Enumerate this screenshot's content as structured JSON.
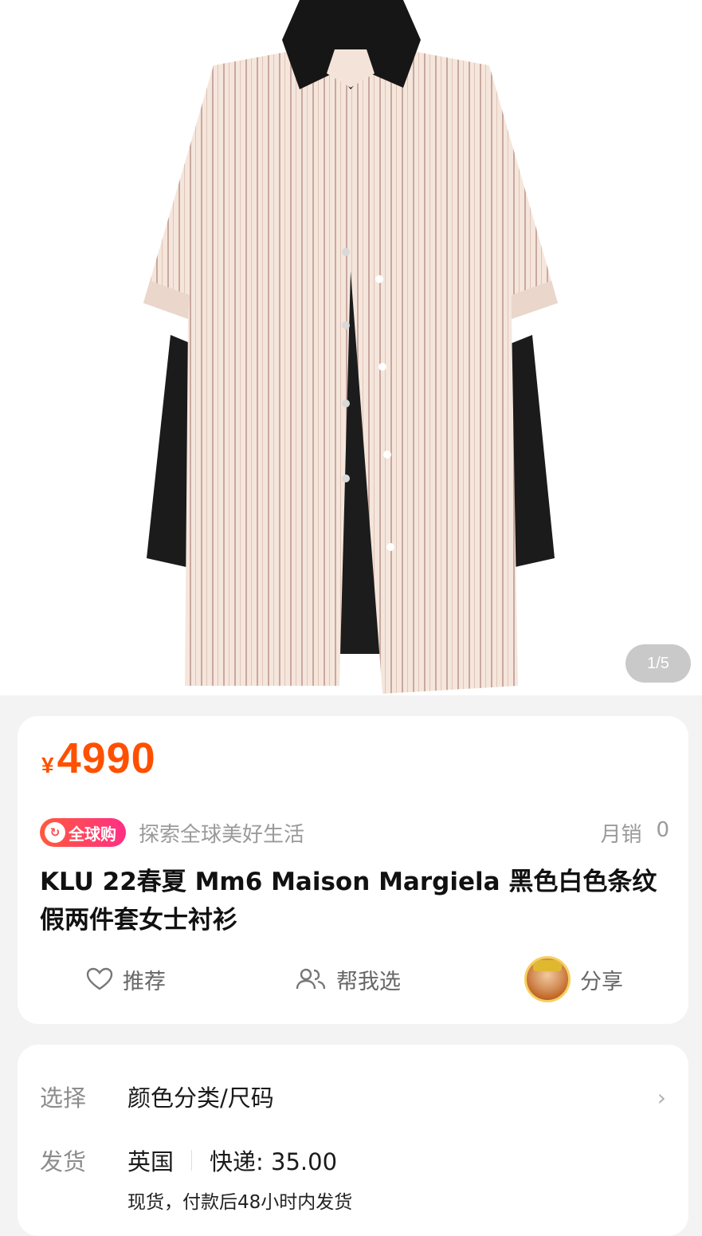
{
  "gallery": {
    "page_indicator": "1/5",
    "image_alt": "shirt-product-photo"
  },
  "price": {
    "symbol": "¥",
    "value": "4990"
  },
  "tags": {
    "badge_label": "全球购",
    "slogan": "探索全球美好生活",
    "monthly_sales_label": "月销",
    "monthly_sales_value": "0"
  },
  "product": {
    "title": "KLU 22春夏 Mm6 Maison Margiela 黑色白色条纹 假两件套女士衬衫"
  },
  "actions": {
    "recommend_label": "推荐",
    "help_choose_label": "帮我选",
    "share_label": "分享"
  },
  "spec": {
    "select_label": "选择",
    "select_value": "颜色分类/尺码",
    "ship_label": "发货",
    "ship_origin": "英国",
    "ship_fee": "快递:  35.00",
    "ship_note": "现货，付款后48小时内发货"
  },
  "colors": {
    "accent": "#ff5000",
    "badge_start": "#ff5a3c",
    "badge_end": "#ff2f85"
  }
}
